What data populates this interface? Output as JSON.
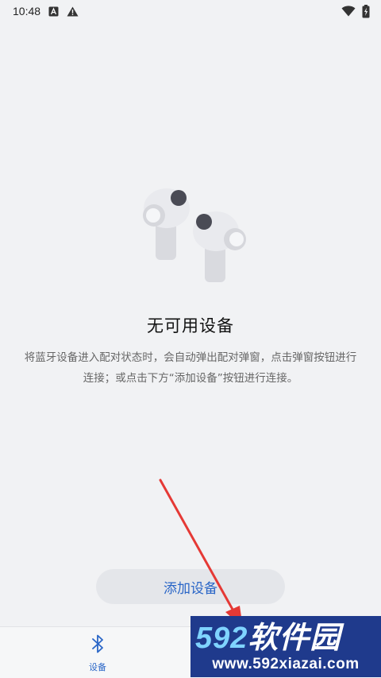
{
  "status_bar": {
    "time": "10:48",
    "icons": [
      "notification-a-icon",
      "warning-icon",
      "wifi-icon",
      "battery-charging-icon"
    ]
  },
  "empty_state": {
    "illustration": "earbuds-icon",
    "title": "无可用设备",
    "description": "将蓝牙设备进入配对状态时，会自动弹出配对弹窗，点击弹窗按钮进行连接；或点击下方“添加设备”按钮进行连接。"
  },
  "actions": {
    "add_device_label": "添加设备"
  },
  "bottom_nav": {
    "items": [
      {
        "label": "设备",
        "icon": "bluetooth-icon",
        "active": true
      }
    ]
  },
  "watermark": {
    "logo_num": "592",
    "logo_text": "软件园",
    "url": "www.592xiazai.com"
  },
  "colors": {
    "accent": "#2a66c7",
    "background": "#f1f2f4",
    "button_bg": "#e4e6ea",
    "annotation": "#e53935",
    "watermark_bg": "#1f3a8c"
  }
}
